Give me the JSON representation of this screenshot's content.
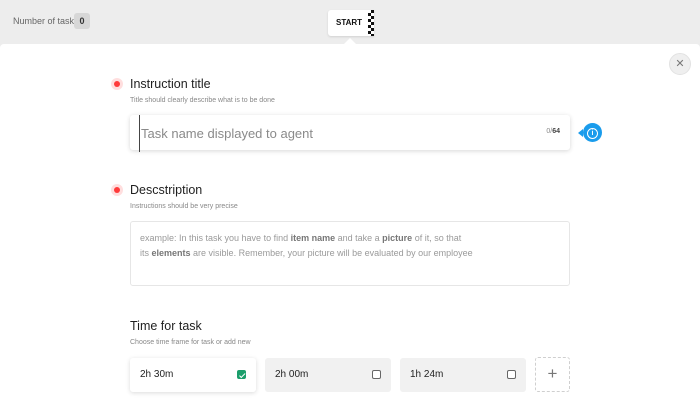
{
  "header": {
    "tasks_label": "Number of tasks",
    "tasks_count": "0",
    "start_label": "START"
  },
  "instruction": {
    "title": "Instruction title",
    "subtitle": "Title should clearly describe what is to be done",
    "placeholder": "Task name displayed to agent",
    "value": "",
    "counter_current": "0/",
    "counter_max": "64"
  },
  "description": {
    "title": "Descstription",
    "subtitle": "Instructions should be very precise",
    "placeholder_parts": [
      {
        "text": "example: In this task you have to find ",
        "bold": false
      },
      {
        "text": "item name",
        "bold": true
      },
      {
        "text": " and take a ",
        "bold": false
      },
      {
        "text": "picture",
        "bold": true
      },
      {
        "text": " of it, so that",
        "bold": false
      },
      {
        "text": "its ",
        "bold": false,
        "newline": true
      },
      {
        "text": "elements",
        "bold": true
      },
      {
        "text": " are visible. Remember, your picture will be evaluated by our employee",
        "bold": false
      }
    ]
  },
  "time": {
    "title": "Time for task",
    "subtitle": "Choose time frame for task or add new",
    "options": [
      {
        "label": "2h 30m",
        "selected": true
      },
      {
        "label": "2h 00m",
        "selected": false
      },
      {
        "label": "1h 24m",
        "selected": false
      }
    ],
    "add_symbol": "+"
  },
  "icons": {
    "close": "close-icon",
    "info": "info-icon",
    "required": "required-dot-icon",
    "add": "plus-icon",
    "flag": "checkered-flag-icon"
  },
  "colors": {
    "accent_blue": "#1a9cec",
    "required_red": "#ff3b3b",
    "check_green": "#1b9e6b"
  }
}
